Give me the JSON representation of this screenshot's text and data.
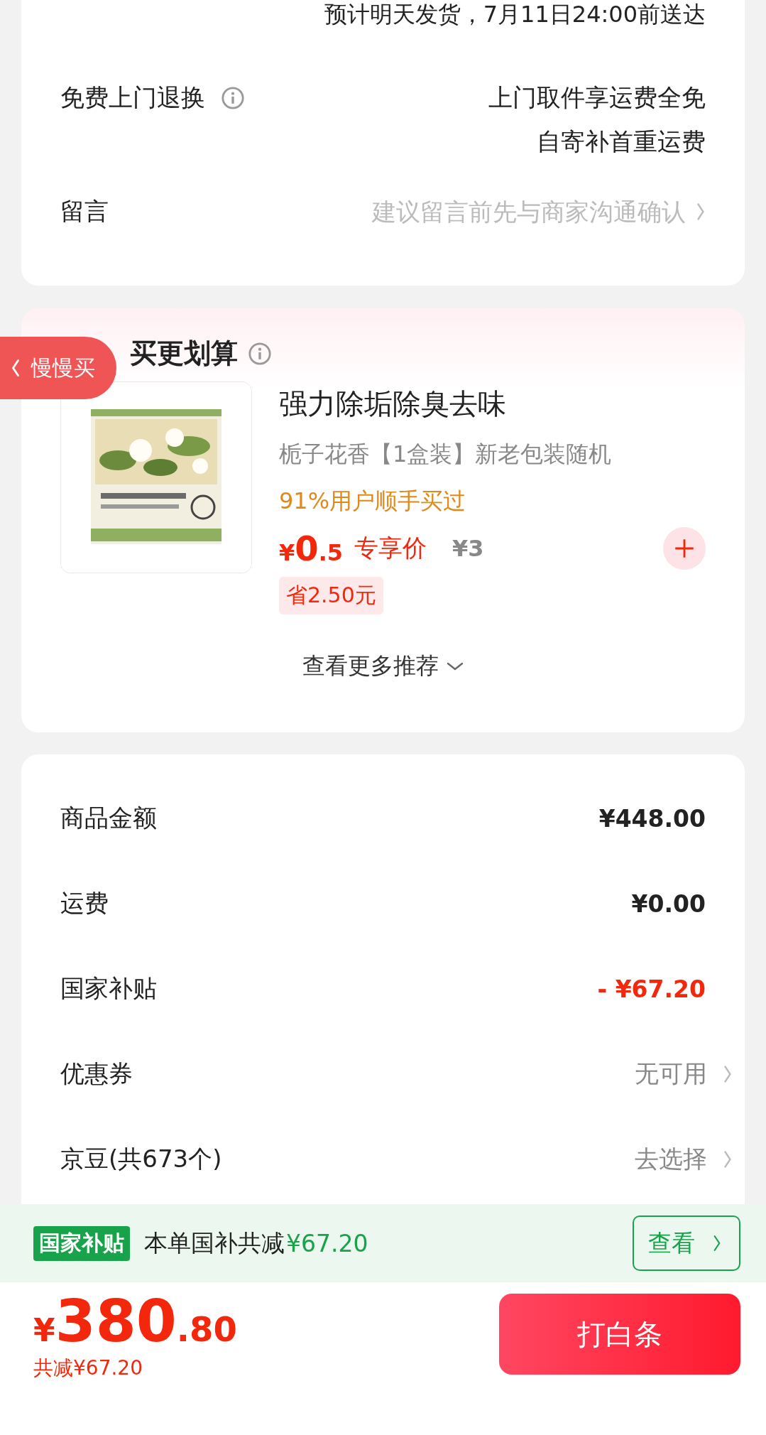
{
  "delivery": {
    "text": "预计明天发货，7月11日24:00前送达"
  },
  "return_service": {
    "label": "免费上门退换",
    "lines": [
      "上门取件享运费全免",
      "自寄补首重运费"
    ]
  },
  "message": {
    "label": "留言",
    "placeholder": "建议留言前先与商家沟通确认"
  },
  "addon": {
    "title": "买更划算",
    "tab": "慢慢买",
    "product": {
      "name": "强力除垢除臭去味",
      "spec": "栀子花香【1盒装】新老包装随机",
      "social_proof": "91%用户顺手买过",
      "price_symbol": "¥",
      "price_int": "0",
      "price_dec": ".5",
      "price_label": "专享价",
      "original_price": "¥3",
      "saving": "省2.50元"
    },
    "more": "查看更多推荐"
  },
  "summary": [
    {
      "label": "商品金额",
      "value": "¥448.00",
      "kind": "amount"
    },
    {
      "label": "运费",
      "value": "¥0.00",
      "kind": "amount"
    },
    {
      "label": "国家补贴",
      "value": "- ¥67.20",
      "kind": "discount"
    },
    {
      "label": "优惠券",
      "value": "无可用",
      "kind": "link"
    },
    {
      "label": "京豆(共673个)",
      "value": "去选择",
      "kind": "link"
    }
  ],
  "subsidy_bar": {
    "badge": "国家补贴",
    "text": "本单国补共减",
    "amount": "¥67.20",
    "button": "查看"
  },
  "footer": {
    "currency": "¥",
    "total_int": "380",
    "total_dec": ".80",
    "saving": "共减¥67.20",
    "pay_button": "打白条"
  }
}
